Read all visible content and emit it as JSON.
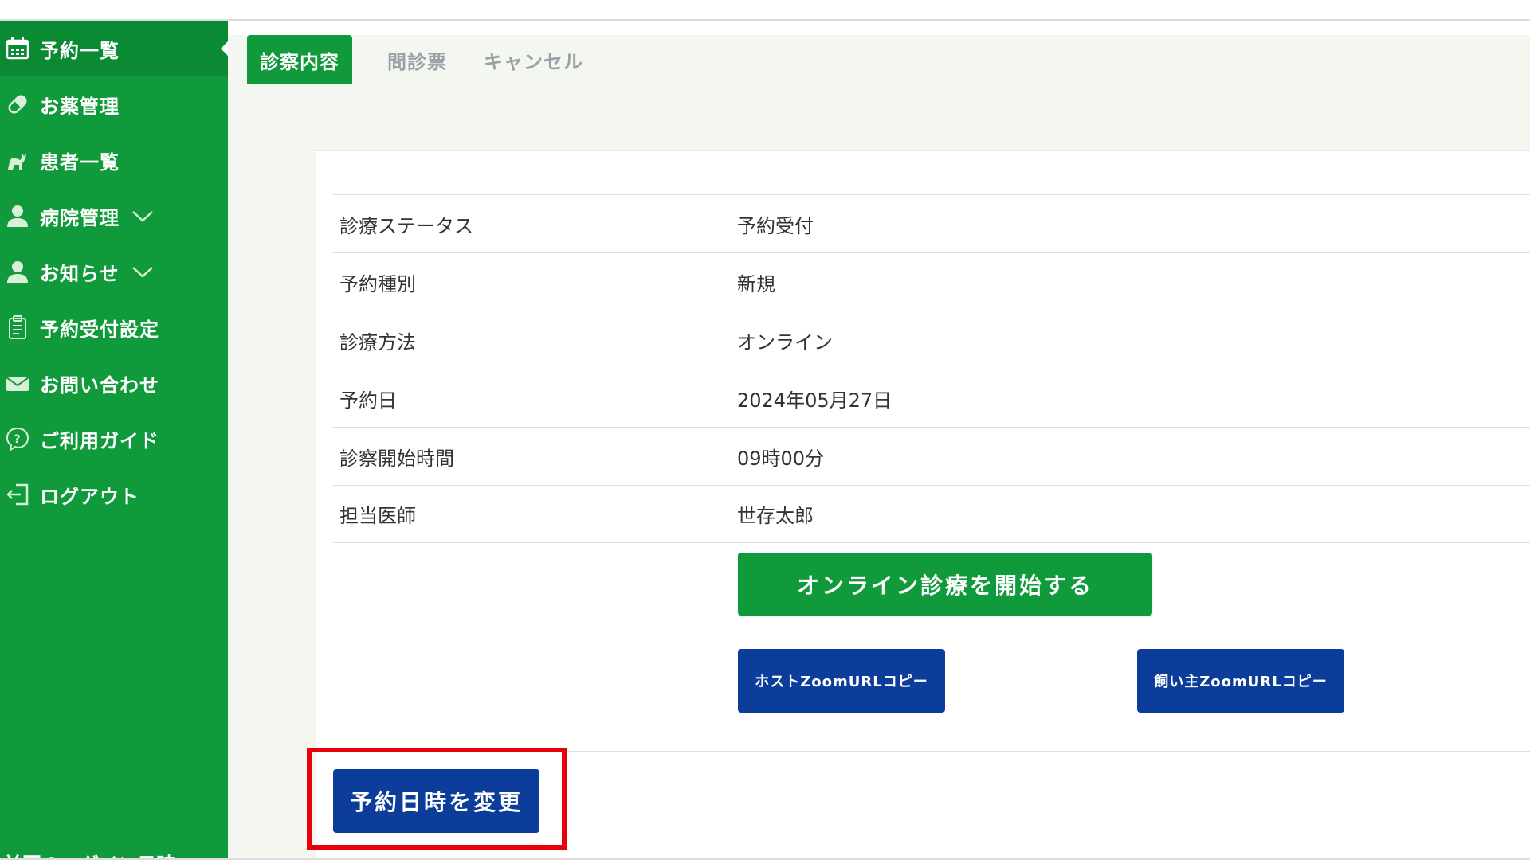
{
  "sidebar": {
    "items": [
      {
        "label": "予約一覧",
        "icon": "calendar-icon"
      },
      {
        "label": "お薬管理",
        "icon": "pill-icon"
      },
      {
        "label": "患者一覧",
        "icon": "pet-icon"
      },
      {
        "label": "病院管理",
        "icon": "person-icon"
      },
      {
        "label": "お知らせ",
        "icon": "person-icon"
      },
      {
        "label": "予約受付設定",
        "icon": "clipboard-icon"
      },
      {
        "label": "お問い合わせ",
        "icon": "mail-icon"
      },
      {
        "label": "ご利用ガイド",
        "icon": "help-icon"
      },
      {
        "label": "ログアウト",
        "icon": "logout-icon"
      }
    ],
    "footer": "前回のログイン日時"
  },
  "tabs": [
    {
      "label": "診察内容"
    },
    {
      "label": "問診票"
    },
    {
      "label": "キャンセル"
    }
  ],
  "details": [
    {
      "label": "診療ステータス",
      "value": "予約受付"
    },
    {
      "label": "予約種別",
      "value": "新規"
    },
    {
      "label": "診療方法",
      "value": "オンライン"
    },
    {
      "label": "予約日",
      "value": "2024年05月27日"
    },
    {
      "label": "診察開始時間",
      "value": "09時00分"
    },
    {
      "label": "担当医師",
      "value": "世存太郎"
    }
  ],
  "actions": {
    "start_online": "オンライン診療を開始する",
    "host_zoom_copy": "ホストZoomURLコピー",
    "owner_zoom_copy": "飼い主ZoomURLコピー",
    "change_datetime": "予約日時を変更"
  },
  "colors": {
    "brand_green": "#109a3c",
    "brand_blue": "#0d3d9a",
    "highlight_red": "#e8000b"
  }
}
